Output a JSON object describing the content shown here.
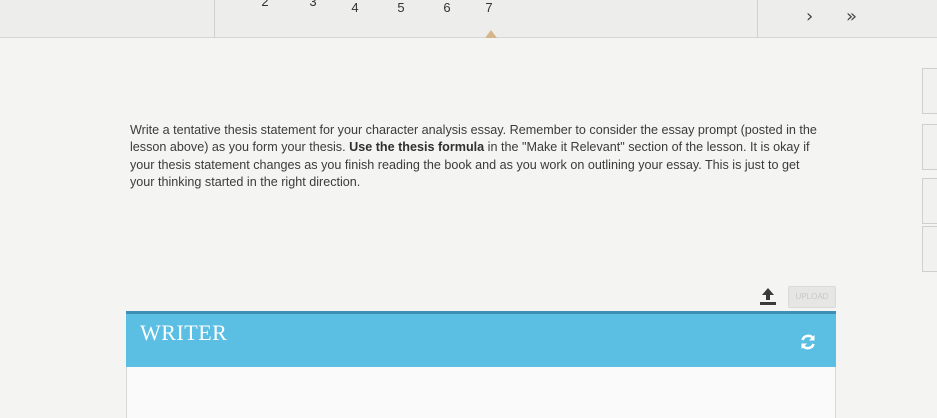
{
  "pager": {
    "pages": [
      "2",
      "3",
      "4",
      "5",
      "6",
      "7"
    ],
    "active_page": "7",
    "next_symbol": "›",
    "last_symbol": "»"
  },
  "prompt": {
    "part1": "Write a tentative thesis statement for your character analysis essay. Remember to consider the essay prompt (posted in the lesson above) as you form your thesis. ",
    "bold": "Use the thesis formula",
    "part2": " in the \"Make it Relevant\" section of the lesson. It is okay if your thesis statement changes as you finish reading the book and as you work on outlining your essay. This is just to get your thinking started in the right direction."
  },
  "upload": {
    "label": "UPLOAD"
  },
  "writer": {
    "title": "WRITER"
  },
  "colors": {
    "writer_header": "#5bbfe3",
    "writer_border": "#3e8fb5",
    "active_marker": "#d6b58a"
  },
  "icons": {
    "upload": "upload-icon",
    "refresh": "refresh-icon"
  }
}
